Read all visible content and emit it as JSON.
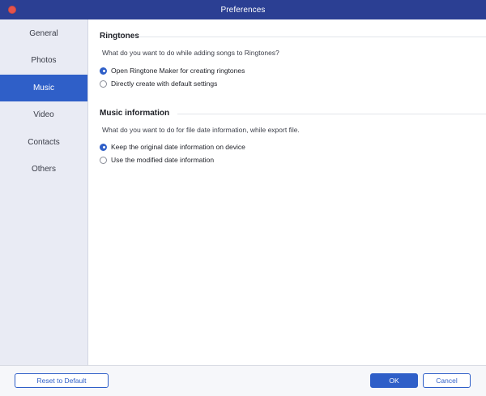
{
  "window": {
    "title": "Preferences"
  },
  "sidebar": {
    "items": [
      {
        "label": "General"
      },
      {
        "label": "Photos"
      },
      {
        "label": "Music",
        "active": true
      },
      {
        "label": "Video"
      },
      {
        "label": "Contacts"
      },
      {
        "label": "Others"
      }
    ]
  },
  "ringtones": {
    "header": "Ringtones",
    "question": "What do you want to do while adding songs to Ringtones?",
    "options": [
      {
        "label": "Open Ringtone Maker for creating ringtones",
        "selected": true
      },
      {
        "label": "Directly create with default settings",
        "selected": false
      }
    ]
  },
  "music_info": {
    "header": "Music information",
    "question": "What do you want to do for file date information, while export file.",
    "options": [
      {
        "label": "Keep the original date information on device",
        "selected": true
      },
      {
        "label": "Use the modified date information",
        "selected": false
      }
    ]
  },
  "footer": {
    "reset_label": "Reset to Default",
    "ok_label": "OK",
    "cancel_label": "Cancel"
  },
  "colors": {
    "titlebar": "#2b3f93",
    "accent": "#2f5fc8",
    "sidebar_bg": "#e9ebf4",
    "close_button": "#e5534b"
  }
}
